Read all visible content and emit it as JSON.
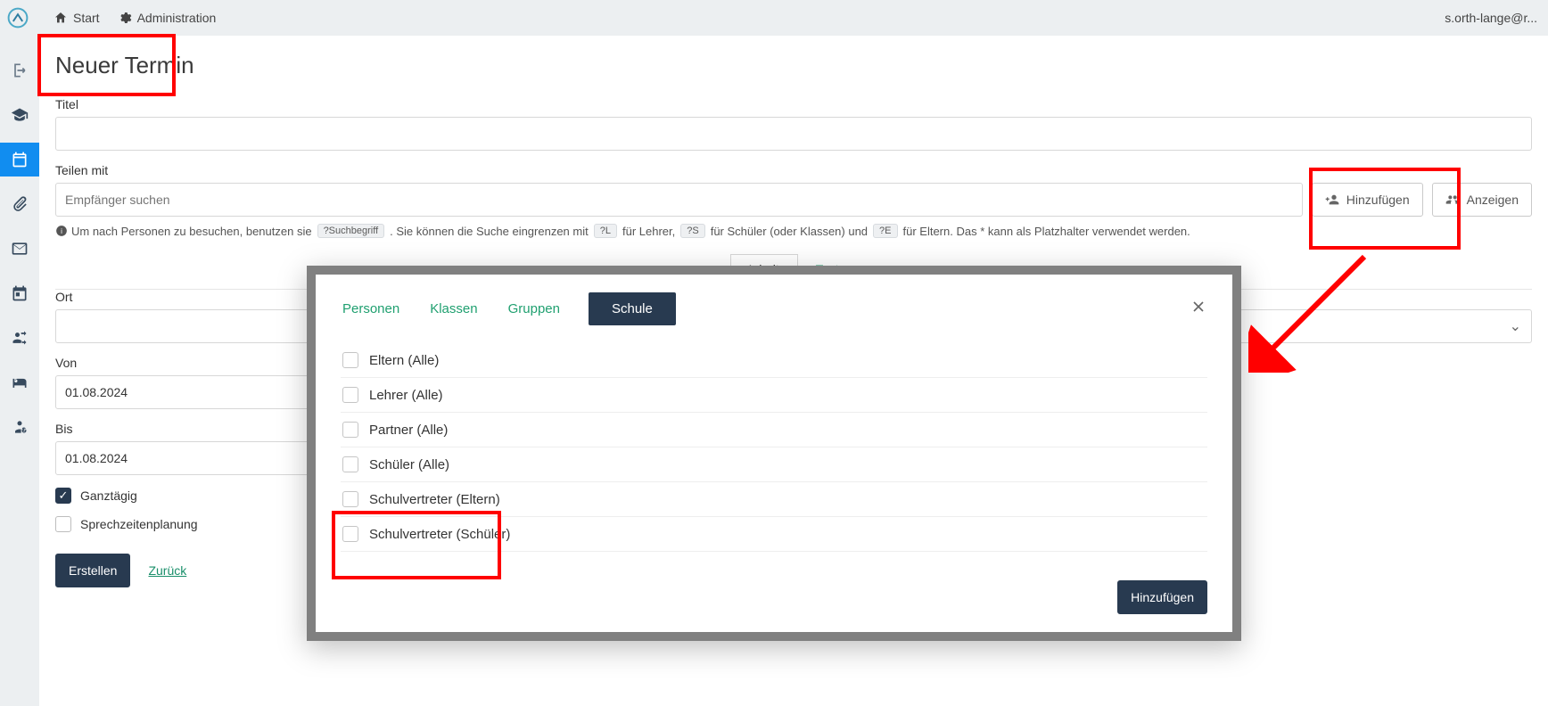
{
  "topbar": {
    "start": "Start",
    "admin": "Administration",
    "user": "s.orth-lange@r..."
  },
  "page": {
    "title": "Neuer Termin"
  },
  "form": {
    "title_label": "Titel",
    "share_label": "Teilen mit",
    "share_placeholder": "Empfänger suchen",
    "add_btn": "Hinzufügen",
    "show_btn": "Anzeigen",
    "hint_pre": "Um nach Personen zu besuchen, benutzen sie",
    "hint_kbd_search": "?Suchbegriff",
    "hint_mid1": ". Sie können die Suche eingrenzen mit",
    "hint_kbd_l": "?L",
    "hint_l_txt": "für Lehrer,",
    "hint_kbd_s": "?S",
    "hint_s_txt": "für Schüler (oder Klassen) und",
    "hint_kbd_e": "?E",
    "hint_e_txt": "für Eltern. Das * kann als Platzhalter verwendet werden.",
    "tab_inhalt": "Inhalt",
    "tab_text": "Text",
    "ort_label": "Ort",
    "von_label": "Von",
    "von_value": "01.08.2024",
    "bis_label": "Bis",
    "bis_value": "01.08.2024",
    "allday": "Ganztägig",
    "sprech": "Sprechzeitenplanung",
    "create": "Erstellen",
    "back": "Zurück"
  },
  "modal": {
    "tabs": {
      "personen": "Personen",
      "klassen": "Klassen",
      "gruppen": "Gruppen",
      "schule": "Schule"
    },
    "items": [
      "Eltern (Alle)",
      "Lehrer (Alle)",
      "Partner (Alle)",
      "Schüler (Alle)",
      "Schulvertreter (Eltern)",
      "Schulvertreter (Schüler)"
    ],
    "add": "Hinzufügen"
  }
}
